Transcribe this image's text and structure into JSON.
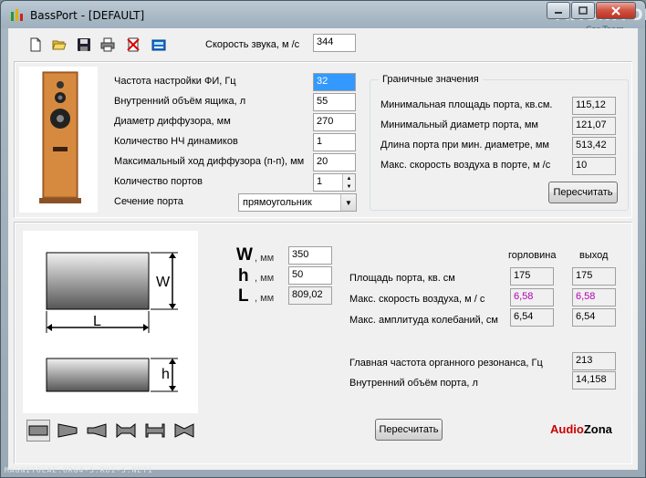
{
  "window": {
    "title": "BassPort - [DEFAULT]",
    "watermark": "MAGNITOLA",
    "watermark_sub": "Car Team"
  },
  "toolbar": {
    "sound_speed_label": "Скорость звука, м /с",
    "sound_speed_value": "344",
    "icons": [
      "new-file-icon",
      "open-folder-icon",
      "save-icon",
      "print-icon",
      "delete-icon",
      "calculator-icon"
    ]
  },
  "params": {
    "tuning_freq_label": "Частота настройки ФИ, Гц",
    "tuning_freq_value": "32",
    "box_volume_label": "Внутренний объём ящика, л",
    "box_volume_value": "55",
    "cone_diameter_label": "Диаметр диффузора, мм",
    "cone_diameter_value": "270",
    "woofer_count_label": "Количество НЧ динамиков",
    "woofer_count_value": "1",
    "max_excursion_label": "Максимальный ход диффузора (п-п), мм",
    "max_excursion_value": "20",
    "port_count_label": "Количество портов",
    "port_count_value": "1",
    "port_section_label": "Сечение порта",
    "port_section_value": "прямоугольник"
  },
  "limits": {
    "group_label": "Граничные значения",
    "min_area_label": "Минимальная площадь порта, кв.см.",
    "min_area_value": "115,12",
    "min_diameter_label": "Минимальный диаметр порта, мм",
    "min_diameter_value": "121,07",
    "port_length_label": "Длина порта при мин. диаметре, мм",
    "port_length_value": "513,42",
    "max_air_speed_label": "Макс. скорость воздуха в порте, м /с",
    "max_air_speed_value": "10",
    "recalc_label": "Пересчитать"
  },
  "dims": {
    "w_letter": "W",
    "h_letter": "h",
    "l_letter": "L",
    "unit": ", мм",
    "w_value": "350",
    "h_value": "50",
    "l_value": "809,02",
    "diagram_w": "W",
    "diagram_l": "L",
    "diagram_h": "h"
  },
  "results": {
    "col_throat": "горловина",
    "col_exit": "выход",
    "area_label": "Площадь порта, кв. см",
    "area_throat": "175",
    "area_exit": "175",
    "air_speed_label": "Макс. скорость воздуха, м / с",
    "air_speed_throat": "6,58",
    "air_speed_exit": "6,58",
    "amplitude_label": "Макс. амплитуда колебаний, см",
    "amplitude_throat": "6,54",
    "amplitude_exit": "6,54",
    "resonance_label": "Главная частота органного резонанса, Гц",
    "resonance_value": "213",
    "port_volume_label": "Внутренний объём порта, л",
    "port_volume_value": "14,158",
    "recalc_label": "Пересчитать"
  },
  "shapes": [
    "straight-port-icon",
    "flared-one-side-icon",
    "flared-other-side-icon",
    "double-flared-icon",
    "flanged-icon",
    "hourglass-icon"
  ],
  "brand": {
    "part1": "Audio",
    "part2": "Zona",
    "color1": "#cc0000",
    "color2": "#000000"
  },
  "status": "MAGNITOLAE.ORG4-5.RU1-5.NET1"
}
